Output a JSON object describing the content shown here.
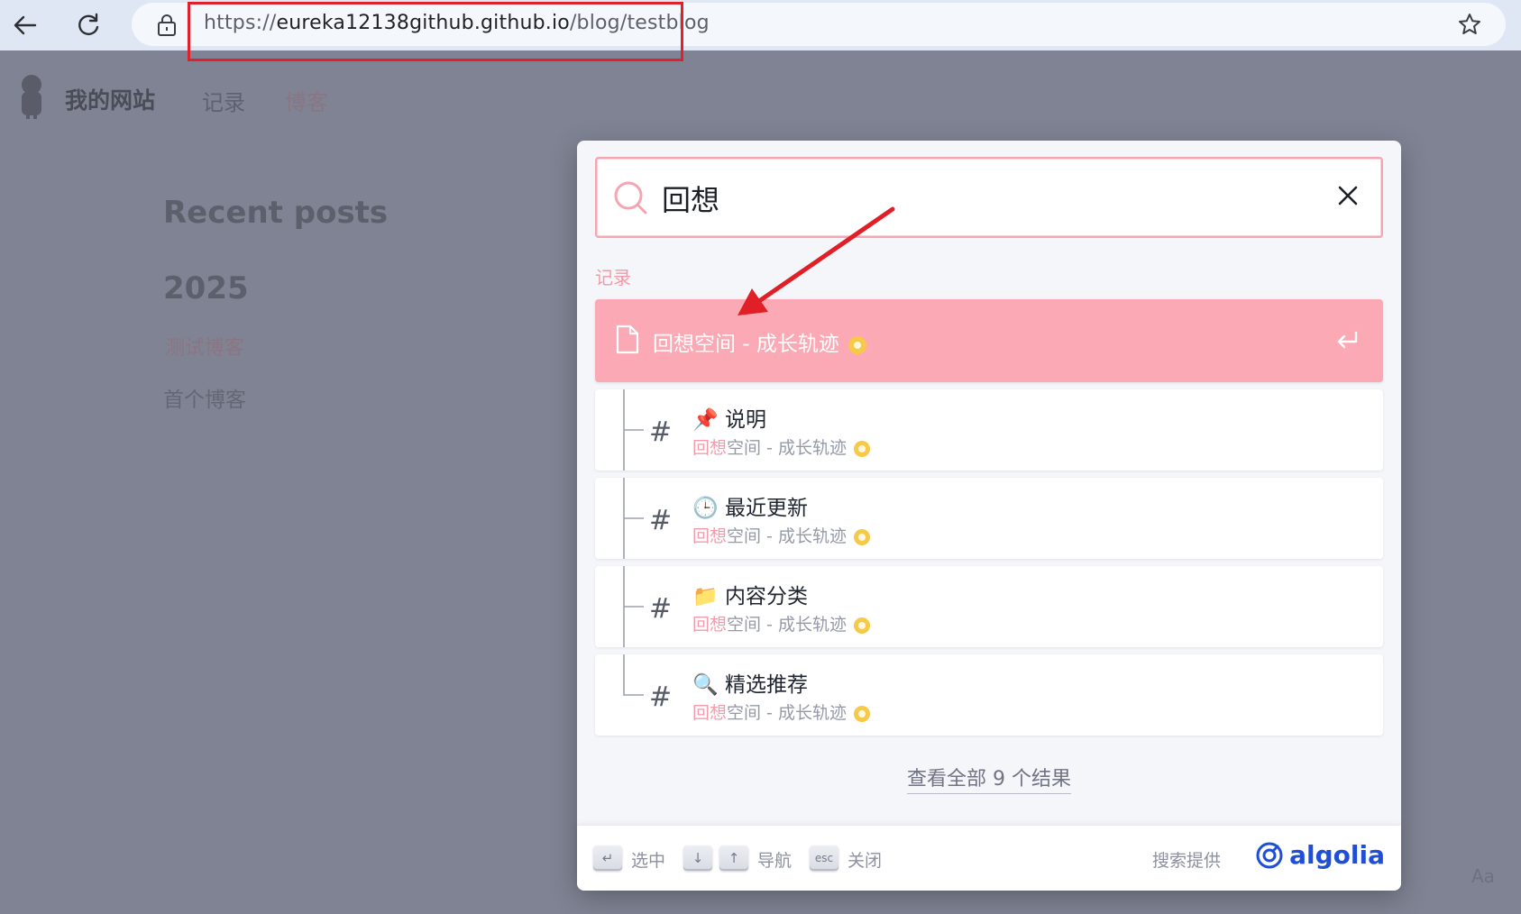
{
  "browser": {
    "url_prefix": "https://",
    "url_domain": "eureka12138github.github.io",
    "url_path": "/blog/testblog"
  },
  "site": {
    "title": "我的网站",
    "nav": [
      {
        "label": "记录"
      },
      {
        "label": "博客"
      }
    ],
    "recent_posts_heading": "Recent posts",
    "year": "2025",
    "posts": [
      "测试博客",
      "首个博客"
    ],
    "reader_toggle": "Aa"
  },
  "search": {
    "query": "回想",
    "source_title": "记录",
    "main_hit": {
      "title": "回想空间 - 成长轨迹"
    },
    "hits": [
      {
        "emoji": "📌",
        "title": "说明",
        "path_mark": "回想",
        "path_rest": "空间 - 成长轨迹"
      },
      {
        "emoji": "🕒",
        "title": "最近更新",
        "path_mark": "回想",
        "path_rest": "空间 - 成长轨迹"
      },
      {
        "emoji": "📁",
        "title": "内容分类",
        "path_mark": "回想",
        "path_rest": "空间 - 成长轨迹"
      },
      {
        "emoji": "🔍",
        "title": "精选推荐",
        "path_mark": "回想",
        "path_rest": "空间 - 成长轨迹"
      }
    ],
    "see_all": "查看全部 9 个结果",
    "footer": {
      "select_label": "选中",
      "navigate_label": "导航",
      "close_label": "关闭",
      "esc_key": "esc",
      "enter_key": "↵",
      "down_key": "↓",
      "up_key": "↑",
      "powered_by": "搜索提供",
      "provider": "algolia"
    }
  },
  "colors": {
    "accent": "#fba9b4",
    "highlight_box": "#e0202a",
    "algolia_blue": "#1f4fd6"
  }
}
